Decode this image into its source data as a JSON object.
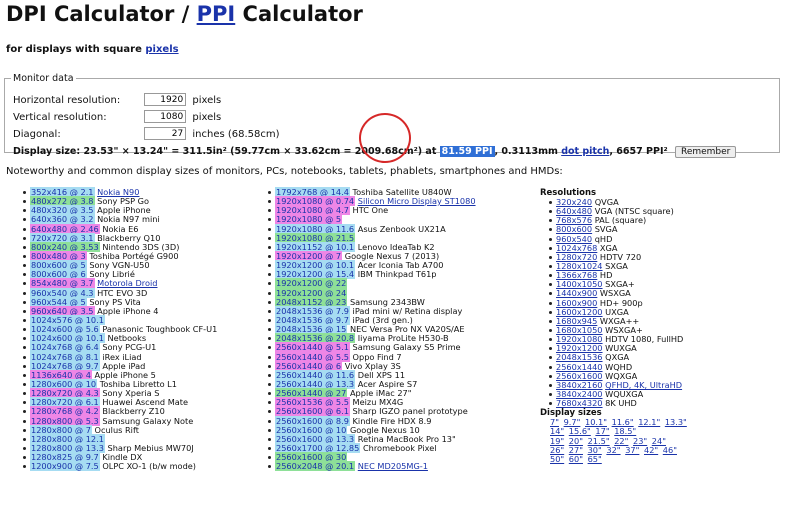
{
  "title": {
    "pre": "DPI Calculator / ",
    "ppi": "PPI",
    "post": " Calculator"
  },
  "subtitle": {
    "pre": "for displays with square ",
    "link": "pixels"
  },
  "monitor": {
    "legend": "Monitor data",
    "h_label": "Horizontal resolution:",
    "h_value": "1920",
    "h_unit": "pixels",
    "v_label": "Vertical resolution:",
    "v_value": "1080",
    "v_unit": "pixels",
    "d_label": "Diagonal:",
    "d_value": "27",
    "d_unit": "inches (68.58cm)",
    "size_pre": "Display size: 23.53\" × 13.24\" = 311.5in² (59.77cm × 33.62cm = 2009.68cm²) at ",
    "ppi_value": "81.59 PPI",
    "size_mid": ", 0.3113mm ",
    "dot_pitch": "dot pitch",
    "size_post": ", 6657 PPI²",
    "remember": "Remember"
  },
  "note": "Noteworthy and common display sizes of monitors, PCs, notebooks, tablets, phablets, smartphones and HMDs:",
  "col1": [
    {
      "t": "352x416 @ 2.1",
      "c": "c-lb",
      "n": "Nokia N90",
      "l": true
    },
    {
      "t": "480x272 @ 3.8",
      "c": "c-gr",
      "n": "Sony PSP Go"
    },
    {
      "t": "480x320 @ 3.5",
      "c": "c-lb",
      "n": "Apple iPhone"
    },
    {
      "t": "640x360 @ 3.2",
      "c": "c-lb",
      "n": "Nokia N97 mini"
    },
    {
      "t": "640x480 @ 2.46",
      "c": "c-pk",
      "n": "Nokia E6"
    },
    {
      "t": "720x720 @ 3.1",
      "c": "c-lb",
      "n": "Blackberry Q10"
    },
    {
      "t": "800x240 @ 3.53",
      "c": "c-gr",
      "n": "Nintendo 3DS (3D)"
    },
    {
      "t": "800x480 @ 3",
      "c": "c-pk",
      "n": "Toshiba Portégé G900"
    },
    {
      "t": "800x600 @ 5",
      "c": "c-lb",
      "n": "Sony VGN-U50"
    },
    {
      "t": "800x600 @ 6",
      "c": "c-lb",
      "n": "Sony Librié"
    },
    {
      "t": "854x480 @ 3.7",
      "c": "c-pk",
      "n": "Motorola Droid",
      "l": true
    },
    {
      "t": "960x540 @ 4.3",
      "c": "c-lb",
      "n": "HTC EVO 3D"
    },
    {
      "t": "960x544 @ 5",
      "c": "c-lb",
      "n": "Sony PS Vita"
    },
    {
      "t": "960x640 @ 3.5",
      "c": "c-pk",
      "n": "Apple iPhone 4"
    },
    {
      "t": "1024x576 @ 10.1",
      "c": "c-lb",
      "n": ""
    },
    {
      "t": "1024x600 @ 5.6",
      "c": "c-lb",
      "n": "Panasonic Toughbook CF-U1"
    },
    {
      "t": "1024x600 @ 10.1",
      "c": "c-lb",
      "n": "Netbooks"
    },
    {
      "t": "1024x768 @ 6.4",
      "c": "c-lb",
      "n": "Sony PCG-U1"
    },
    {
      "t": "1024x768 @ 8.1",
      "c": "c-lb",
      "n": "iRex iLiad"
    },
    {
      "t": "1024x768 @ 9.7",
      "c": "c-lb",
      "n": "Apple iPad"
    },
    {
      "t": "1136x640 @ 4",
      "c": "c-pk",
      "n": "Apple iPhone 5"
    },
    {
      "t": "1280x600 @ 10",
      "c": "c-lb",
      "n": "Toshiba Libretto L1"
    },
    {
      "t": "1280x720 @ 4.3",
      "c": "c-pk",
      "n": "Sony Xperia S"
    },
    {
      "t": "1280x720 @ 6.1",
      "c": "c-lb",
      "n": "Huawei Ascend Mate"
    },
    {
      "t": "1280x768 @ 4.2",
      "c": "c-pk",
      "n": "Blackberry Z10"
    },
    {
      "t": "1280x800 @ 5.3",
      "c": "c-pk",
      "n": "Samsung Galaxy Note"
    },
    {
      "t": "1280x800 @ 7",
      "c": "c-lb",
      "n": "Oculus Rift"
    },
    {
      "t": "1280x800 @ 12.1",
      "c": "c-lb",
      "n": ""
    },
    {
      "t": "1280x800 @ 13.3",
      "c": "c-lb",
      "n": "Sharp Mebius MW70J"
    },
    {
      "t": "1280x825 @ 9.7",
      "c": "c-lb",
      "n": "Kindle DX"
    },
    {
      "t": "1200x900 @ 7.5",
      "c": "c-lb",
      "n": "OLPC XO-1 (b/w mode)"
    }
  ],
  "col2": [
    {
      "t": "1792x768 @ 14.4",
      "c": "c-lb",
      "n": "Toshiba Satellite U840W"
    },
    {
      "t": "1920x1080 @ 0.74",
      "c": "c-pk",
      "n": "Silicon Micro Display ST1080",
      "l": true
    },
    {
      "t": "1920x1080 @ 4.7",
      "c": "c-pk",
      "n": "HTC One"
    },
    {
      "t": "1920x1080 @ 5",
      "c": "c-pk",
      "n": ""
    },
    {
      "t": "1920x1080 @ 11.6",
      "c": "c-lb",
      "n": "Asus Zenbook UX21A"
    },
    {
      "t": "1920x1080 @ 21.5",
      "c": "c-gr",
      "n": ""
    },
    {
      "t": "1920x1152 @ 10.1",
      "c": "c-lb",
      "n": "Lenovo IdeaTab K2"
    },
    {
      "t": "1920x1200 @ 7",
      "c": "c-pk",
      "n": "Google Nexus 7 (2013)"
    },
    {
      "t": "1920x1200 @ 10.1",
      "c": "c-lb",
      "n": "Acer Iconia Tab A700"
    },
    {
      "t": "1920x1200 @ 15.4",
      "c": "c-lb",
      "n": "IBM Thinkpad T61p"
    },
    {
      "t": "1920x1200 @ 22",
      "c": "c-gr",
      "n": ""
    },
    {
      "t": "1920x1200 @ 24",
      "c": "c-gr",
      "n": ""
    },
    {
      "t": "2048x1152 @ 23",
      "c": "c-gr",
      "n": "Samsung 2343BW"
    },
    {
      "t": "2048x1536 @ 7.9",
      "c": "c-lb",
      "n": "iPad mini w/ Retina display"
    },
    {
      "t": "2048x1536 @ 9.7",
      "c": "c-lb",
      "n": "iPad (3rd gen.)"
    },
    {
      "t": "2048x1536 @ 15",
      "c": "c-lb",
      "n": "NEC Versa Pro NX VA20S/AE"
    },
    {
      "t": "2048x1536 @ 20.8",
      "c": "c-gr",
      "n": "Iiyama ProLite H530-B"
    },
    {
      "t": "2560x1440 @ 5.1",
      "c": "c-pk",
      "n": "Samsung Galaxy S5 Prime"
    },
    {
      "t": "2560x1440 @ 5.5",
      "c": "c-pk",
      "n": "Oppo Find 7"
    },
    {
      "t": "2560x1440 @ 6",
      "c": "c-pk",
      "n": "Vivo Xplay 3S"
    },
    {
      "t": "2560x1440 @ 11.6",
      "c": "c-lb",
      "n": "Dell XPS 11"
    },
    {
      "t": "2560x1440 @ 13.3",
      "c": "c-lb",
      "n": "Acer Aspire S7"
    },
    {
      "t": "2560x1440 @ 27",
      "c": "c-gr",
      "n": "Apple iMac 27\""
    },
    {
      "t": "2560x1536 @ 5.5",
      "c": "c-pk",
      "n": "Meizu MX4G"
    },
    {
      "t": "2560x1600 @ 6.1",
      "c": "c-pk",
      "n": "Sharp IGZO panel prototype"
    },
    {
      "t": "2560x1600 @ 8.9",
      "c": "c-lb",
      "n": "Kindle Fire HDX 8.9"
    },
    {
      "t": "2560x1600 @ 10",
      "c": "c-lb",
      "n": "Google Nexus 10"
    },
    {
      "t": "2560x1600 @ 13.3",
      "c": "c-lb",
      "n": "Retina MacBook Pro 13\""
    },
    {
      "t": "2560x1700 @ 12.85",
      "c": "c-lb",
      "n": "Chromebook Pixel"
    },
    {
      "t": "2560x1600 @ 30",
      "c": "c-gr",
      "n": ""
    },
    {
      "t": "2560x2048 @ 20.1",
      "c": "c-gr",
      "n": "NEC MD205MG-1",
      "l": true
    }
  ],
  "res_header": "Resolutions",
  "col3": [
    {
      "t": "320x240",
      "n": "QVGA"
    },
    {
      "t": "640x480",
      "n": "VGA (NTSC square)"
    },
    {
      "t": "768x576",
      "n": "PAL (square)"
    },
    {
      "t": "800x600",
      "n": "SVGA"
    },
    {
      "t": "960x540",
      "n": "qHD"
    },
    {
      "t": "1024x768",
      "n": "XGA"
    },
    {
      "t": "1280x720",
      "n": "HDTV 720"
    },
    {
      "t": "1280x1024",
      "n": "SXGA"
    },
    {
      "t": "1366x768",
      "n": "HD"
    },
    {
      "t": "1400x1050",
      "n": "SXGA+"
    },
    {
      "t": "1440x900",
      "n": "WSXGA"
    },
    {
      "t": "1600x900",
      "n": "HD+ 900p"
    },
    {
      "t": "1600x1200",
      "n": "UXGA"
    },
    {
      "t": "1680x945",
      "n": "WXGA++"
    },
    {
      "t": "1680x1050",
      "n": "WSXGA+"
    },
    {
      "t": "1920x1080",
      "n": "HDTV 1080, FullHD"
    },
    {
      "t": "1920x1200",
      "n": "WUXGA"
    },
    {
      "t": "2048x1536",
      "n": "QXGA"
    },
    {
      "t": "2560x1440",
      "n": "WQHD"
    },
    {
      "t": "2560x1600",
      "n": "WQXGA"
    },
    {
      "t": "3840x2160",
      "n": "QFHD, 4K, UltraHD",
      "l": true
    },
    {
      "t": "3840x2400",
      "n": "WQUXGA"
    },
    {
      "t": "7680x4320",
      "n": "8K UHD"
    }
  ],
  "sizes_header": "Display sizes",
  "sizes": [
    [
      "7\"",
      "9.7\"",
      "10.1\"",
      "11.6\"",
      "12.1\"",
      "13.3\""
    ],
    [
      "14\"",
      "15.6\"",
      "17\"",
      "18.5\""
    ],
    [
      "19\"",
      "20\"",
      "21.5\"",
      "22\"",
      "23\"",
      "24\""
    ],
    [
      "26\"",
      "27\"",
      "30\"",
      "32\"",
      "37\"",
      "42\"",
      "46\""
    ],
    [
      "50\"",
      "60\"",
      "65\""
    ]
  ],
  "colors": {
    "link": "#1a33aa",
    "highlight": "#2f6fd6",
    "circle": "#d62828",
    "tag_blue": "#a6dcf2",
    "tag_pink": "#ee86e6",
    "tag_green": "#8ee098"
  }
}
